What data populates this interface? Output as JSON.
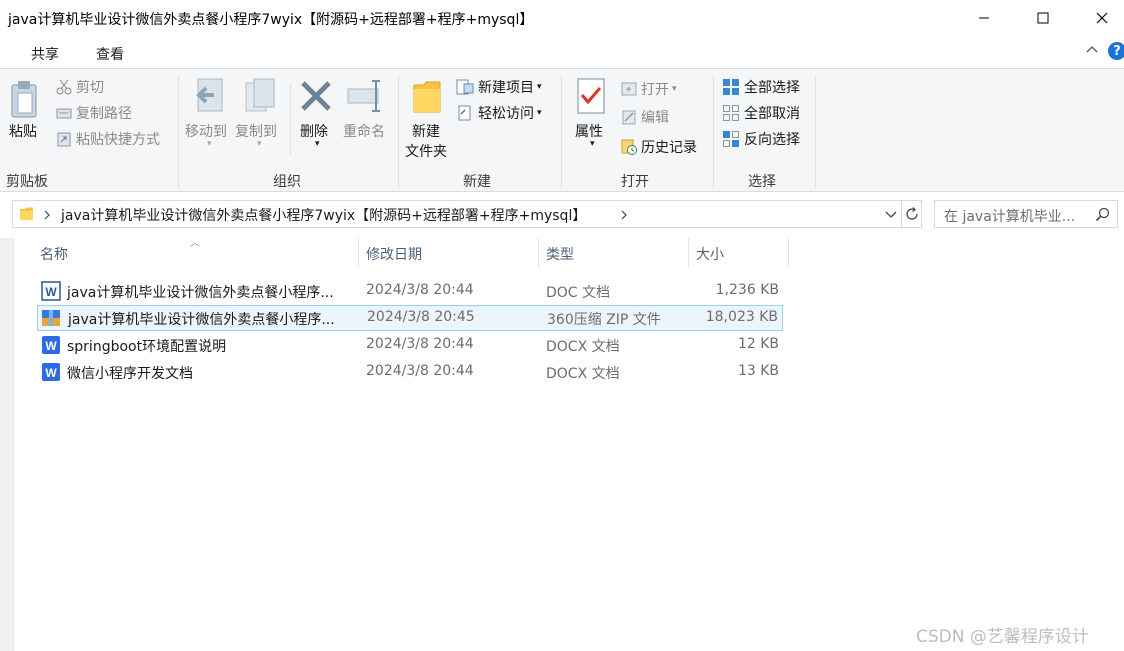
{
  "window": {
    "title": "java计算机毕业设计微信外卖点餐小程序7wyix【附源码+远程部署+程序+mysql】"
  },
  "tabs": {
    "share": "共享",
    "view": "查看"
  },
  "ribbon": {
    "clipboard": {
      "label": "剪贴板",
      "paste": "粘贴",
      "cut": "剪切",
      "copy_path": "复制路径",
      "paste_shortcut": "粘贴快捷方式"
    },
    "organize": {
      "label": "组织",
      "move_to": "移动到",
      "copy_to": "复制到",
      "delete": "删除",
      "rename": "重命名"
    },
    "new": {
      "label": "新建",
      "new_folder_line1": "新建",
      "new_folder_line2": "文件夹",
      "new_item": "新建项目",
      "easy_access": "轻松访问"
    },
    "open": {
      "label": "打开",
      "properties": "属性",
      "open": "打开",
      "edit": "编辑",
      "history": "历史记录"
    },
    "select": {
      "label": "选择",
      "select_all": "全部选择",
      "select_none": "全部取消",
      "invert": "反向选择"
    }
  },
  "address": {
    "path": "java计算机毕业设计微信外卖点餐小程序7wyix【附源码+远程部署+程序+mysql】"
  },
  "search": {
    "placeholder": "在 java计算机毕业..."
  },
  "columns": {
    "name": "名称",
    "date": "修改日期",
    "type": "类型",
    "size": "大小"
  },
  "files": [
    {
      "name": "java计算机毕业设计微信外卖点餐小程序...",
      "date": "2024/3/8 20:44",
      "type": "DOC 文档",
      "size": "1,236 KB",
      "icon": "word-doc-icon"
    },
    {
      "name": "java计算机毕业设计微信外卖点餐小程序...",
      "date": "2024/3/8 20:45",
      "type": "360压缩 ZIP 文件",
      "size": "18,023 KB",
      "icon": "zip-archive-icon"
    },
    {
      "name": "springboot环境配置说明",
      "date": "2024/3/8 20:44",
      "type": "DOCX 文档",
      "size": "12 KB",
      "icon": "word-docx-icon"
    },
    {
      "name": "微信小程序开发文档",
      "date": "2024/3/8 20:44",
      "type": "DOCX 文档",
      "size": "13 KB",
      "icon": "word-docx-icon"
    }
  ],
  "watermark": "CSDN @艺馨程序设计",
  "colors": {
    "accent": "#1a73d9",
    "selection_bg": "#eaf5fd",
    "selection_border": "#9ccff2",
    "ribbon_bg": "#f5f6f7"
  }
}
